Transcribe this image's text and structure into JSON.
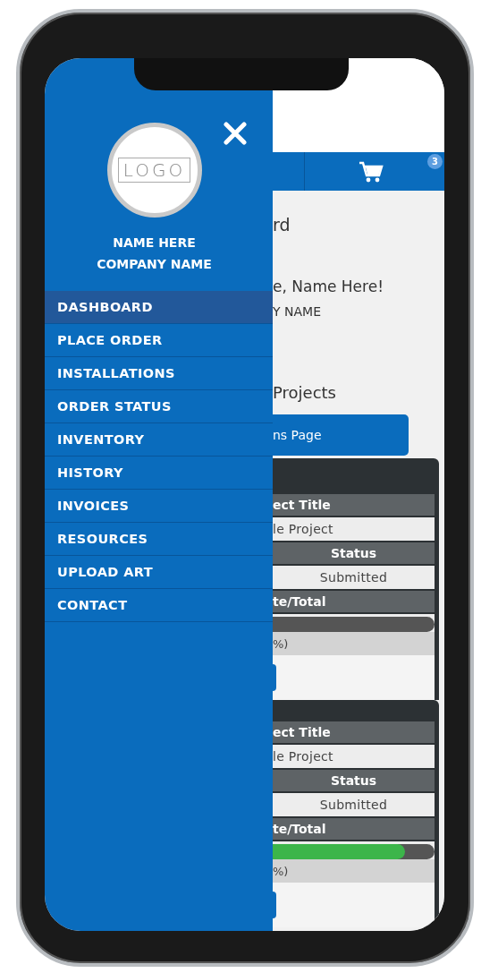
{
  "drawer": {
    "logo": "LOGO",
    "user_name": "NAME HERE",
    "company": "COMPANY NAME",
    "items": [
      {
        "label": "DASHBOARD",
        "selected": true
      },
      {
        "label": "PLACE ORDER",
        "selected": false
      },
      {
        "label": "INSTALLATIONS",
        "selected": false
      },
      {
        "label": "ORDER STATUS",
        "selected": false
      },
      {
        "label": "INVENTORY",
        "selected": false
      },
      {
        "label": "HISTORY",
        "selected": false
      },
      {
        "label": "INVOICES",
        "selected": false
      },
      {
        "label": "RESOURCES",
        "selected": false
      },
      {
        "label": "UPLOAD ART",
        "selected": false
      },
      {
        "label": "CONTACT",
        "selected": false
      }
    ]
  },
  "header": {
    "cart_badge": "3"
  },
  "dashboard": {
    "title": "rd",
    "greeting": "e, Name Here!",
    "company": "Y NAME",
    "section_title": "Projects",
    "button": "ns Page"
  },
  "projects": [
    {
      "title_label": "ect Title",
      "title": "le Project",
      "status_label": "Status",
      "status": "Submitted",
      "progress_label": "te/Total",
      "level": 0,
      "percent": "%)"
    },
    {
      "title_label": "ect Title",
      "title": "le Project",
      "status_label": "Status",
      "status": "Submitted",
      "progress_label": "te/Total",
      "level": 0.82,
      "percent": "%)"
    }
  ]
}
